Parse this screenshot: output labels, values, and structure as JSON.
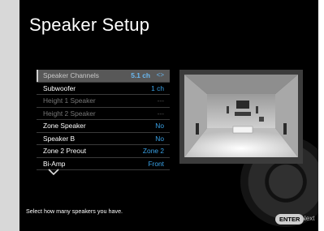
{
  "title": "Speaker Setup",
  "menu": [
    {
      "label": "Speaker Channels",
      "value": "5.1 ch",
      "state": "selected",
      "arrows": "<>"
    },
    {
      "label": "Subwoofer",
      "value": "1 ch",
      "state": "normal"
    },
    {
      "label": "Height 1 Speaker",
      "value": "---",
      "state": "dim"
    },
    {
      "label": "Height 2 Speaker",
      "value": "---",
      "state": "dim"
    },
    {
      "label": "Zone Speaker",
      "value": "No",
      "state": "normal"
    },
    {
      "label": "Speaker B",
      "value": "No",
      "state": "normal"
    },
    {
      "label": "Zone 2 Preout",
      "value": "Zone 2",
      "state": "normal"
    },
    {
      "label": "Bi-Amp",
      "value": "Front",
      "state": "normal"
    }
  ],
  "more_icon": "chevron-down-icon",
  "hint": "Select how many speakers you have.",
  "footer": {
    "enter_label": "ENTER",
    "next_label": "Next"
  },
  "colors": {
    "accent": "#3aa3e8",
    "selected_row": "#585858",
    "background": "#000000"
  }
}
